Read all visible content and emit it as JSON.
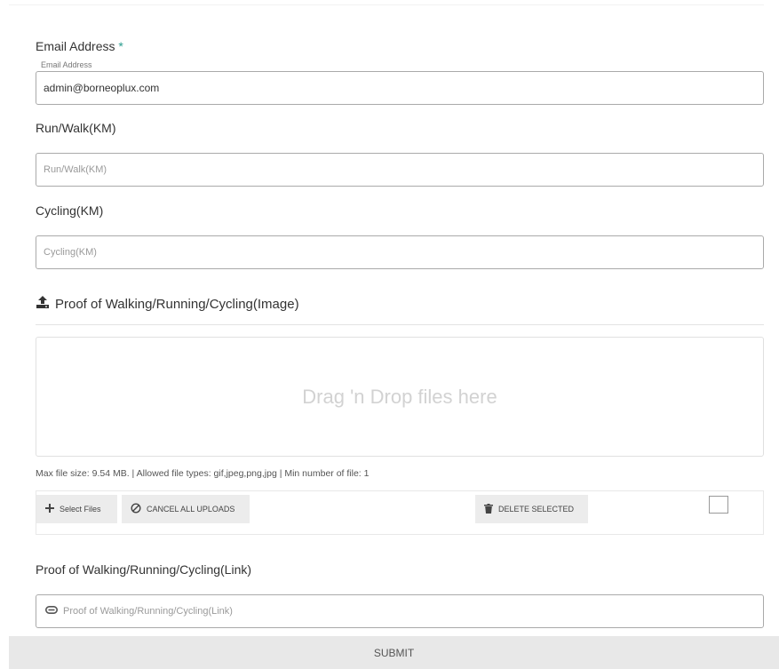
{
  "email": {
    "label": "Email Address",
    "required_mark": "*",
    "small_label": "Email Address",
    "value": "admin@borneoplux.com"
  },
  "run_walk": {
    "label": "Run/Walk(KM)",
    "placeholder": "Run/Walk(KM)"
  },
  "cycling": {
    "label": "Cycling(KM)",
    "placeholder": "Cycling(KM)"
  },
  "proof_image": {
    "title": "Proof of Walking/Running/Cycling(Image)",
    "title_icon": "upload-icon",
    "dropzone_text": "Drag 'n Drop files here",
    "file_info": "Max file size: 9.54 MB. | Allowed file types: gif,jpeg,png,jpg | Min number of file: 1",
    "buttons": {
      "select_files": "Select Files",
      "cancel_all": "CANCEL ALL UPLOADS",
      "delete_selected": "DELETE SELECTED"
    }
  },
  "proof_link": {
    "label": "Proof of Walking/Running/Cycling(Link)",
    "placeholder": "Proof of Walking/Running/Cycling(Link)",
    "icon": "link-icon"
  },
  "submit_label": "SUBMIT",
  "colors": {
    "required": "#2a9d8f",
    "button_bg": "#ececec",
    "submit_bg": "#e8e8e8"
  }
}
